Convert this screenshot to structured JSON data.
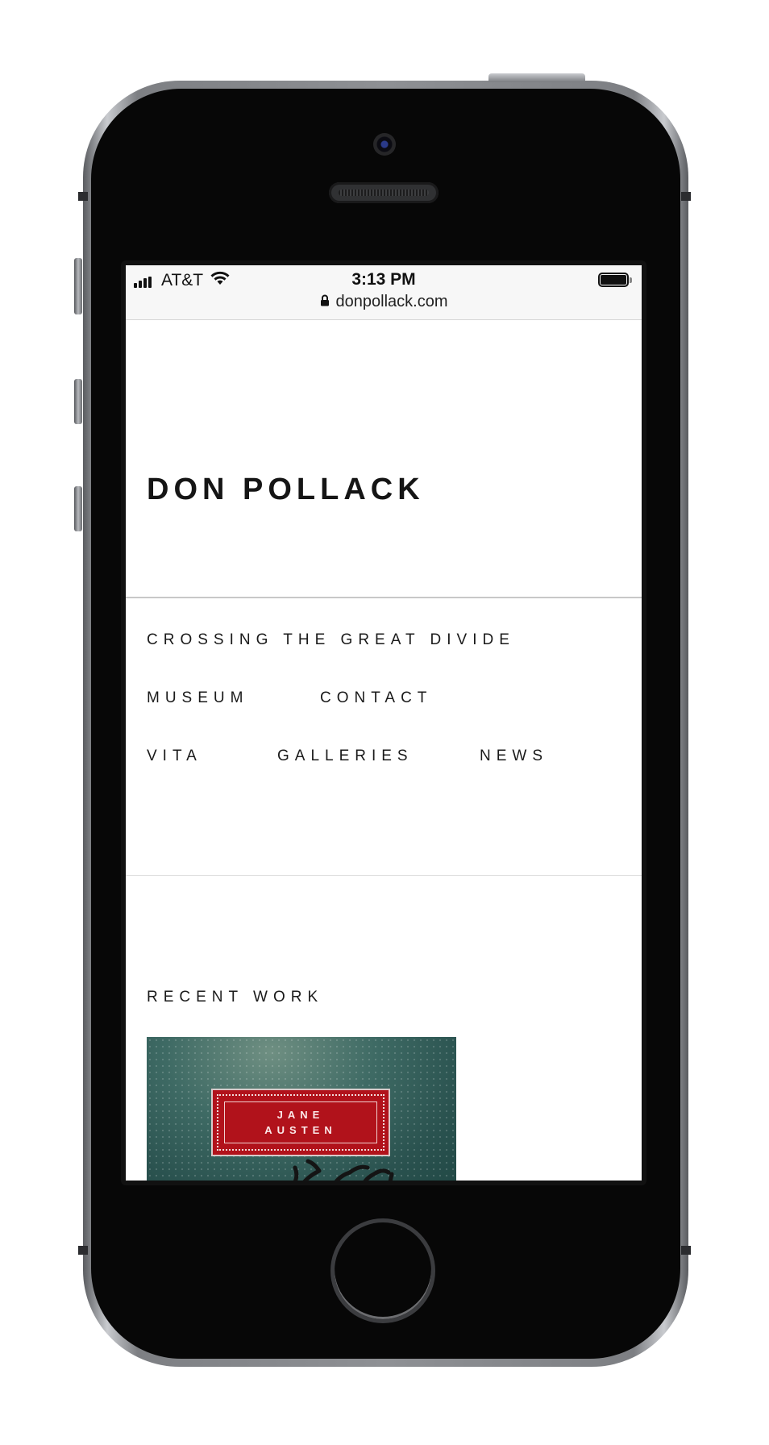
{
  "status_bar": {
    "carrier": "AT&T",
    "time": "3:13 PM",
    "url": "donpollack.com",
    "icons": [
      "signal-icon",
      "wifi-icon",
      "battery-icon",
      "lock-icon"
    ]
  },
  "site": {
    "title": "DON POLLACK"
  },
  "nav": {
    "items": [
      {
        "label": "CROSSING THE GREAT DIVIDE"
      },
      {
        "label": "MUSEUM"
      },
      {
        "label": "CONTACT"
      },
      {
        "label": "VITA"
      },
      {
        "label": "GALLERIES"
      },
      {
        "label": "NEWS"
      }
    ]
  },
  "recent_work": {
    "heading": "RECENT WORK",
    "artwork_text_line1": "JANE",
    "artwork_text_line2": "AUSTEN"
  },
  "colors": {
    "plate_red": "#b1121b",
    "artwork_teal": "#3e6a64",
    "text": "#151515"
  }
}
